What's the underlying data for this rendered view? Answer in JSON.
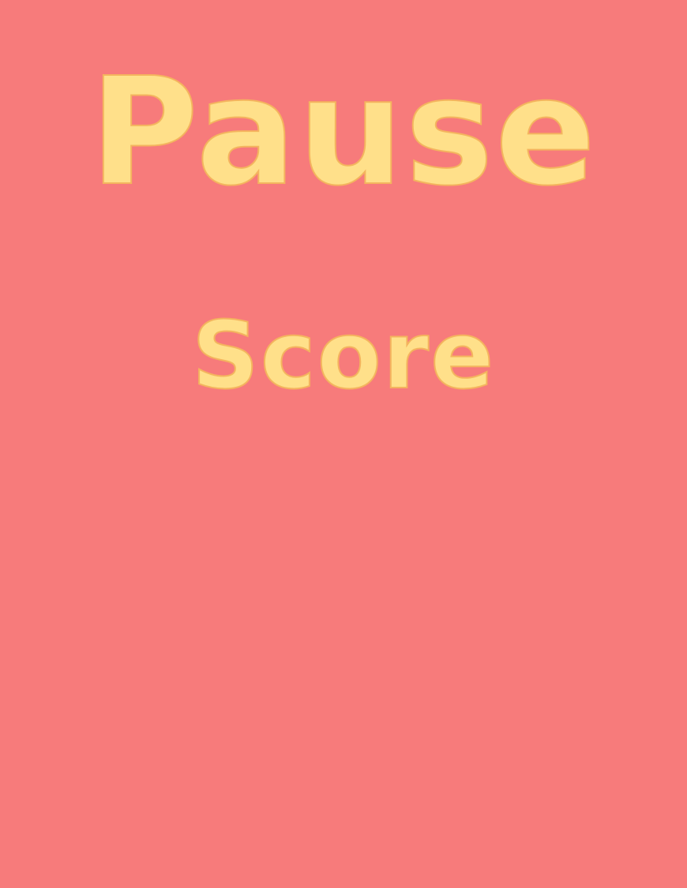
{
  "pause_screen": {
    "title": "Pause",
    "score_label": "Score"
  },
  "colors": {
    "background": "#f77b7b",
    "text": "#ffe08a",
    "text_outline": "#f4b45e"
  }
}
